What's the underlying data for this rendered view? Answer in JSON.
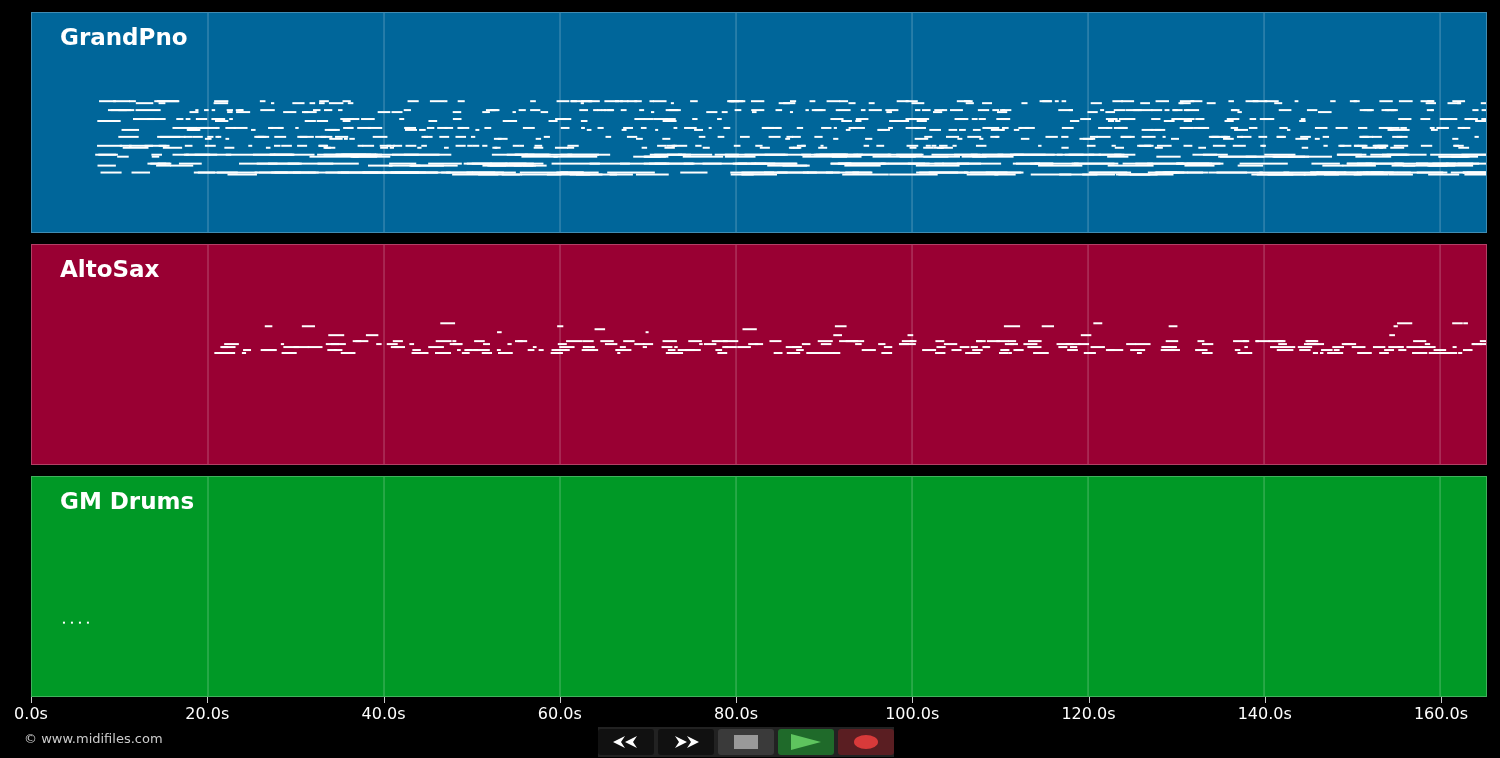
{
  "tracks": [
    {
      "name": "GrandPno",
      "color": "#00669a",
      "kind": "piano"
    },
    {
      "name": "AltoSax",
      "color": "#990033",
      "kind": "sax"
    },
    {
      "name": "GM Drums",
      "color": "#009926",
      "kind": "drums"
    }
  ],
  "time_axis": {
    "ticks": [
      "0.0s",
      "20.0s",
      "40.0s",
      "60.0s",
      "80.0s",
      "100.0s",
      "120.0s",
      "140.0s",
      "160.0s"
    ]
  },
  "copyright": "© www.midifiles.com",
  "transport": [
    {
      "kind": "rewind"
    },
    {
      "kind": "forward"
    },
    {
      "kind": "stop"
    },
    {
      "kind": "play"
    },
    {
      "kind": "record"
    }
  ]
}
